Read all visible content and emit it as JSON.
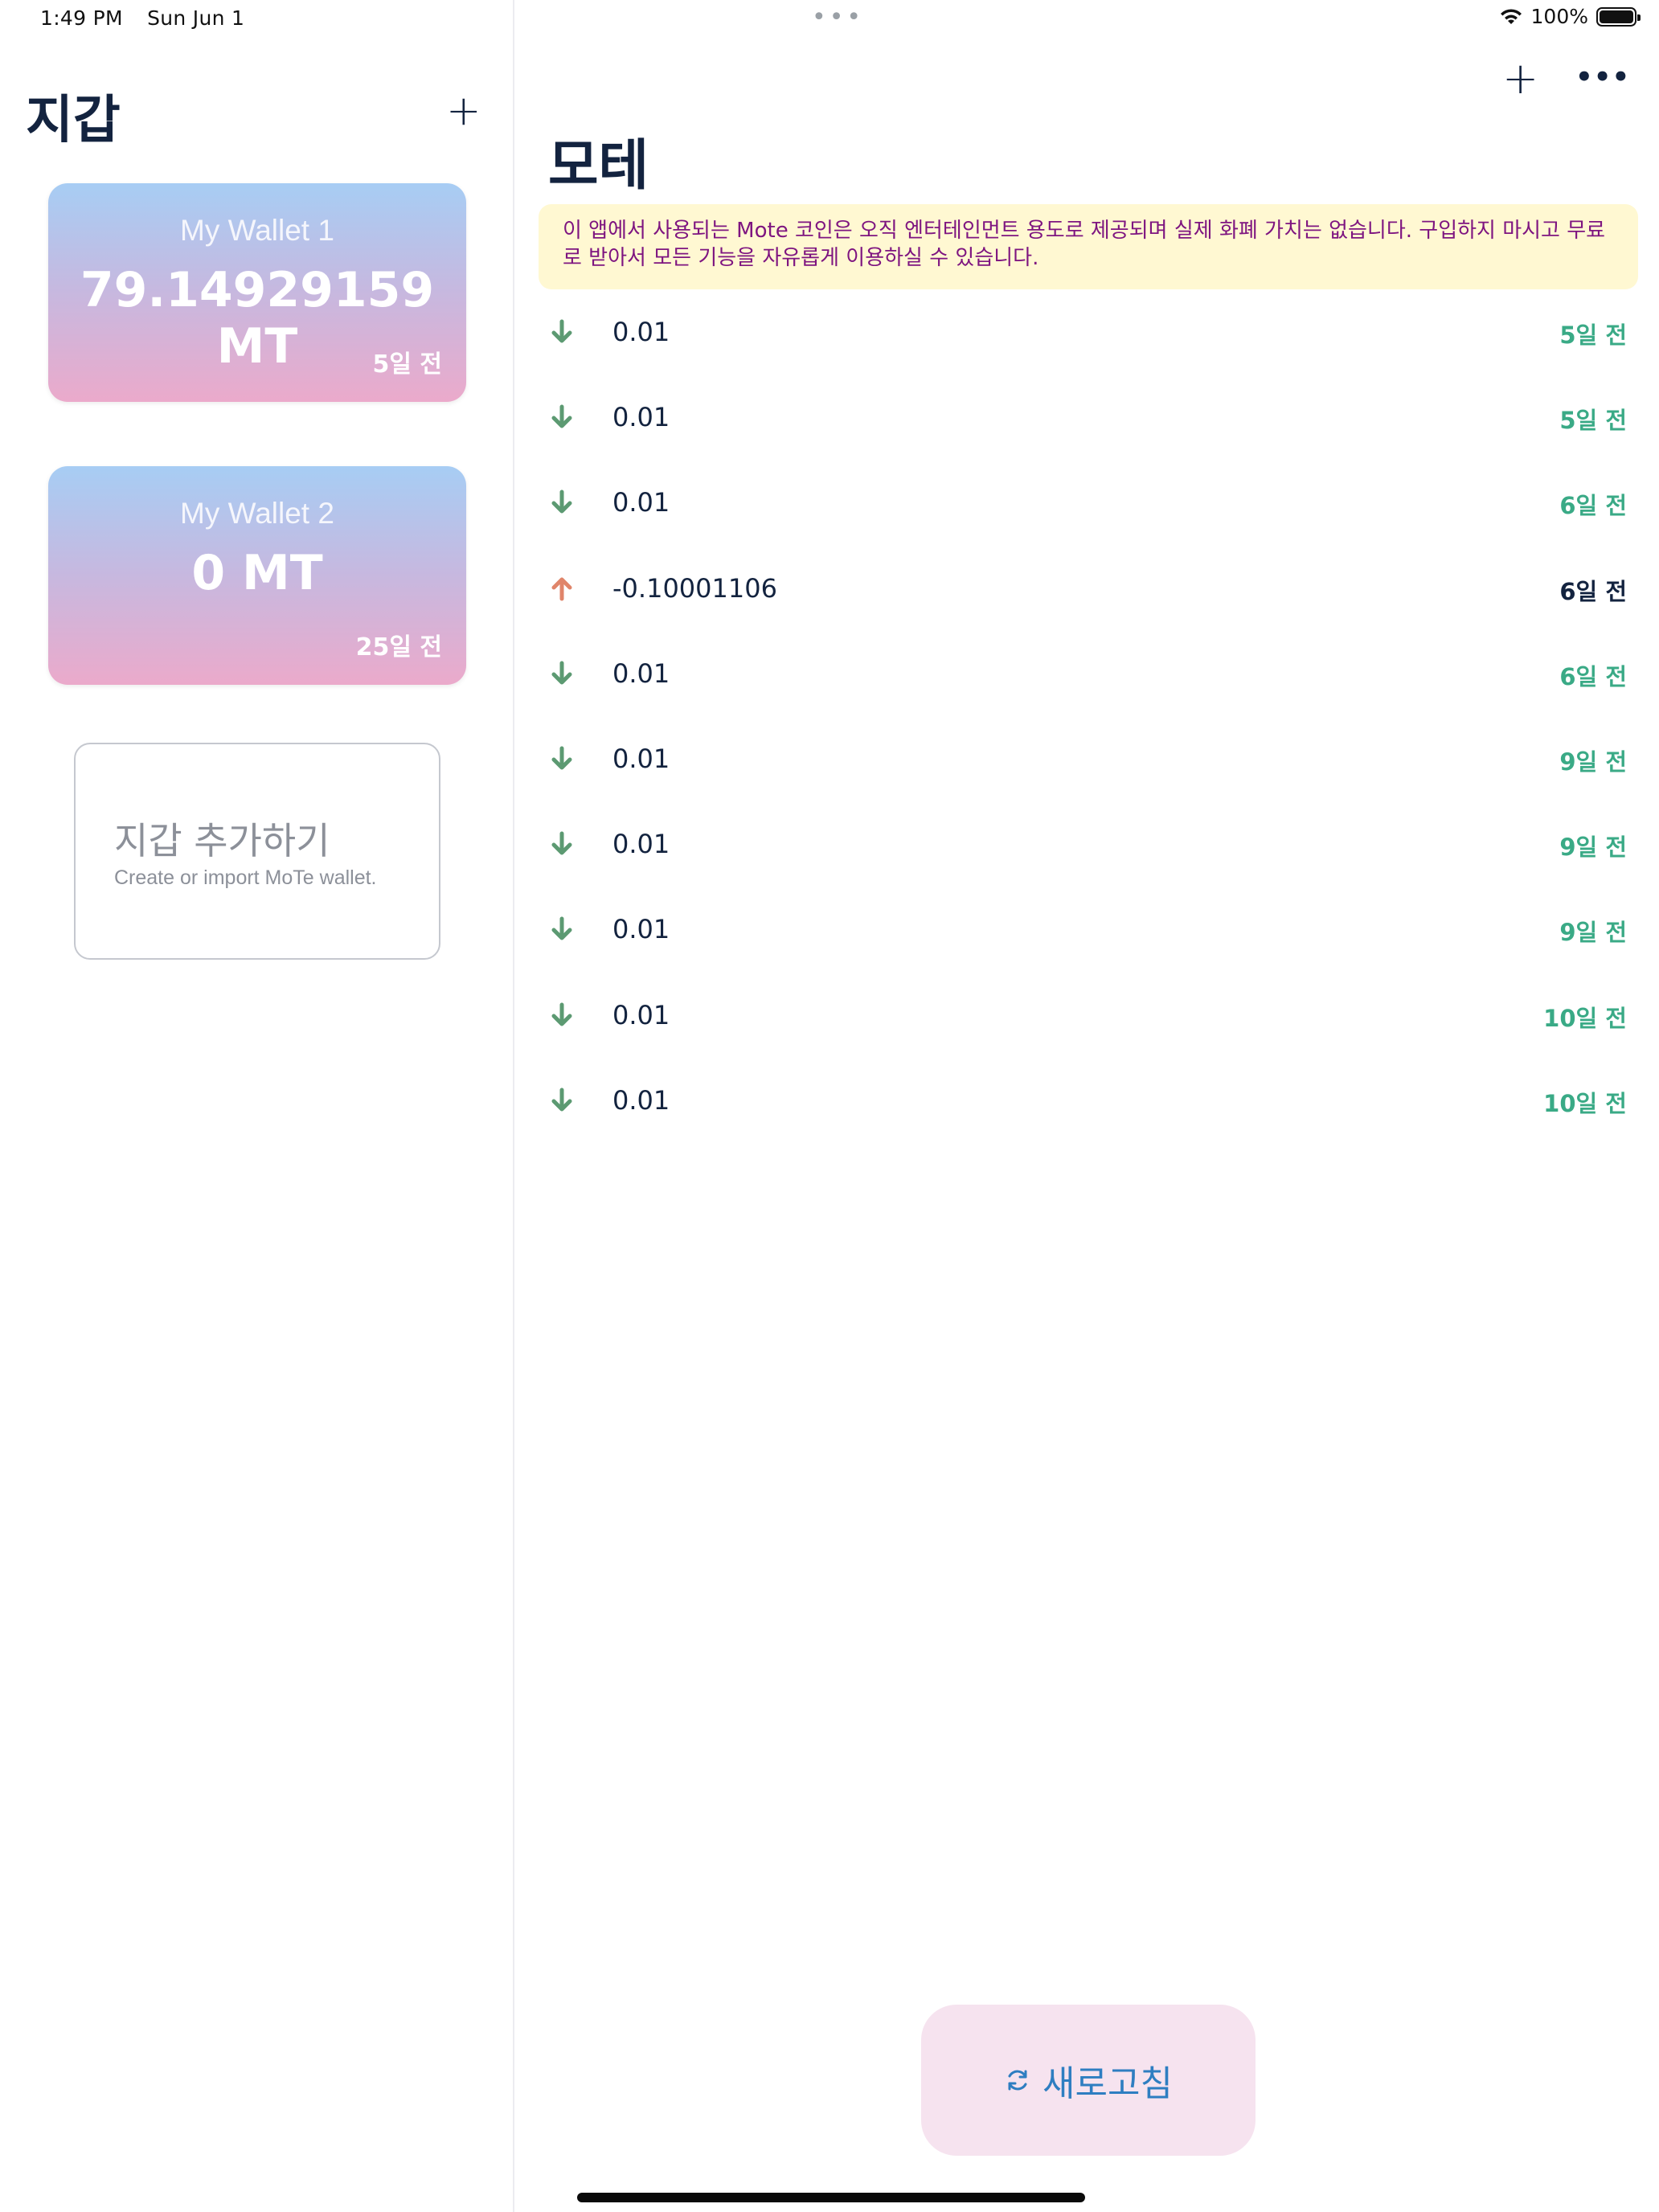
{
  "status_bar": {
    "time": "1:49 PM",
    "date": "Sun Jun 1",
    "battery": "100%"
  },
  "sidebar": {
    "title": "지갑",
    "add_icon": "plus-icon",
    "wallets": [
      {
        "name": "My Wallet 1",
        "balance": "79.14929159 MT",
        "time": "5일 전"
      },
      {
        "name": "My Wallet 2",
        "balance": "0 MT",
        "time": "25일 전"
      }
    ],
    "add_wallet": {
      "title": "지갑 추가하기",
      "subtitle": "Create or import MoTe wallet."
    }
  },
  "main": {
    "title": "모테",
    "toolbar": {
      "add_icon": "plus-icon",
      "more_icon": "ellipsis-icon"
    },
    "notice": "이 앱에서 사용되는 Mote 코인은 오직 엔터테인먼트 용도로 제공되며 실제 화폐 가치는 없습니다. 구입하지 마시고 무료로 받아서 모든 기능을 자유롭게 이용하실 수 있습니다.",
    "transactions": [
      {
        "direction": "in",
        "amount": "0.01",
        "time": "5일 전"
      },
      {
        "direction": "in",
        "amount": "0.01",
        "time": "5일 전"
      },
      {
        "direction": "in",
        "amount": "0.01",
        "time": "6일 전"
      },
      {
        "direction": "out",
        "amount": "-0.10001106",
        "time": "6일 전"
      },
      {
        "direction": "in",
        "amount": "0.01",
        "time": "6일 전"
      },
      {
        "direction": "in",
        "amount": "0.01",
        "time": "9일 전"
      },
      {
        "direction": "in",
        "amount": "0.01",
        "time": "9일 전"
      },
      {
        "direction": "in",
        "amount": "0.01",
        "time": "9일 전"
      },
      {
        "direction": "in",
        "amount": "0.01",
        "time": "10일 전"
      },
      {
        "direction": "in",
        "amount": "0.01",
        "time": "10일 전"
      }
    ],
    "refresh": {
      "label": "새로고침",
      "icon": "refresh-icon"
    }
  },
  "colors": {
    "incoming": "#5c9a72",
    "outgoing": "#e0856a",
    "time_green": "#3aaa86",
    "notice_bg": "#fff8d2",
    "notice_text": "#7e1580"
  }
}
